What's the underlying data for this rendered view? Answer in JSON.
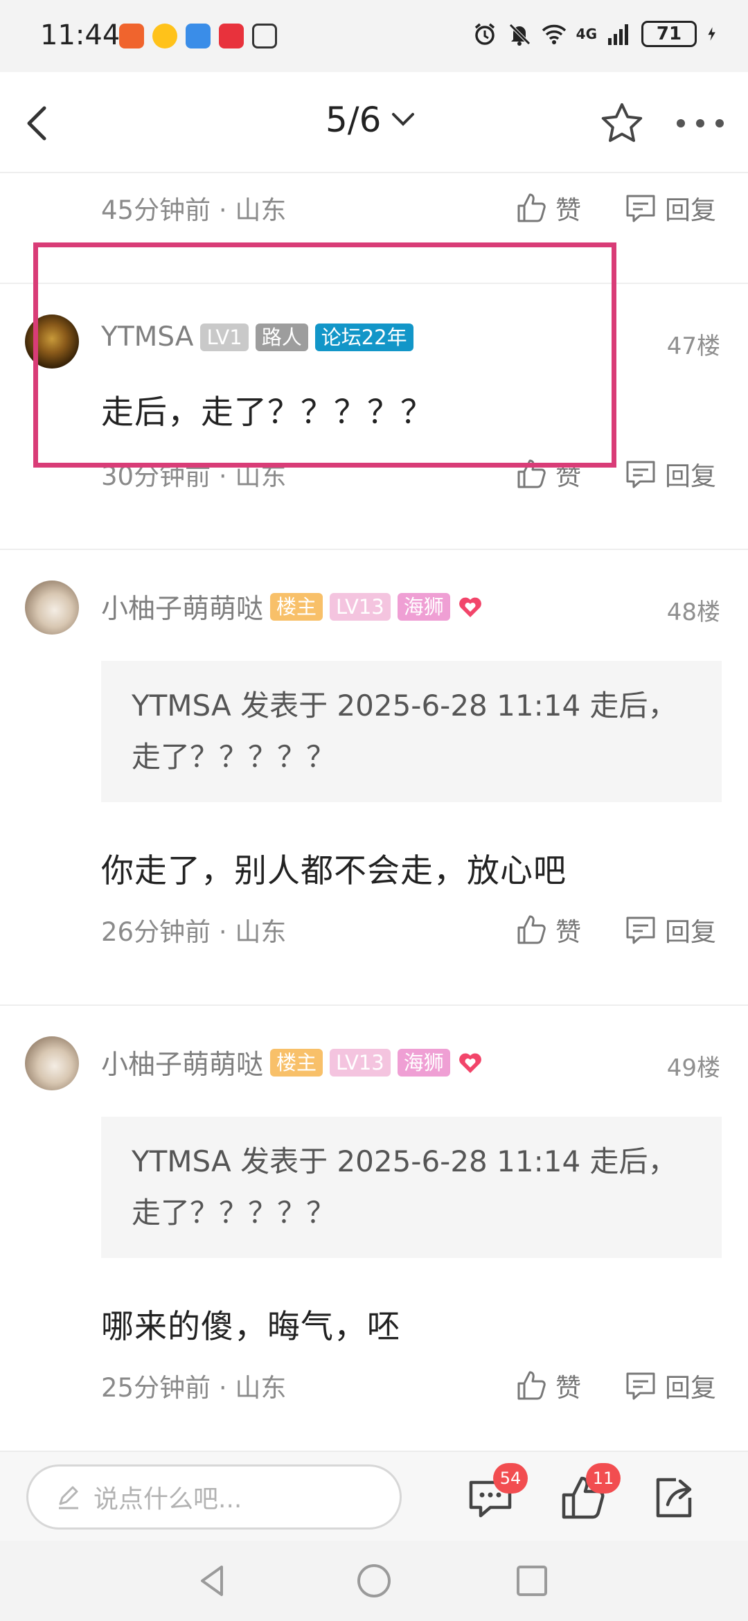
{
  "status_bar": {
    "time": "11:44",
    "network": "4G",
    "battery": "71",
    "app_icons": [
      "app-1-icon",
      "weibo-icon",
      "app-3-icon",
      "app-4-icon",
      "nfc-icon"
    ]
  },
  "nav": {
    "page": "5/6"
  },
  "top_meta": {
    "time": "45分钟前 · 山东",
    "like": "赞",
    "reply": "回复"
  },
  "posts": [
    {
      "username": "YTMSA",
      "badges": [
        "LV1",
        "路人",
        "论坛22年"
      ],
      "floor": "47楼",
      "content": "走后，走了？？？？？",
      "time": "30分钟前 · 山东",
      "like": "赞",
      "reply": "回复"
    },
    {
      "username": "小柚子萌萌哒",
      "badges": [
        "楼主",
        "LV13",
        "海狮"
      ],
      "floor": "48楼",
      "quote": "YTMSA 发表于 2025-6-28 11:14 走后，走了？？？？？",
      "content": "你走了，别人都不会走，放心吧",
      "time": "26分钟前 · 山东",
      "like": "赞",
      "reply": "回复"
    },
    {
      "username": "小柚子萌萌哒",
      "badges": [
        "楼主",
        "LV13",
        "海狮"
      ],
      "floor": "49楼",
      "quote": "YTMSA 发表于 2025-6-28 11:14 走后，走了？？？？？",
      "content": "哪来的傻，晦气，呸",
      "time": "25分钟前 · 山东",
      "like": "赞",
      "reply": "回复"
    }
  ],
  "bottom_bar": {
    "placeholder": "说点什么吧...",
    "comment_count": "54",
    "like_count": "11"
  },
  "colors": {
    "highlight": "#d93c77",
    "badge_lv1": "#c9c9c9",
    "badge_passerby": "#9d9d9d",
    "badge_years": "#1296c8",
    "badge_owner": "#f8c069",
    "badge_lv13": "#f4c4df",
    "badge_sealion": "#ef9fd4",
    "count_bubble": "#f24d50"
  }
}
